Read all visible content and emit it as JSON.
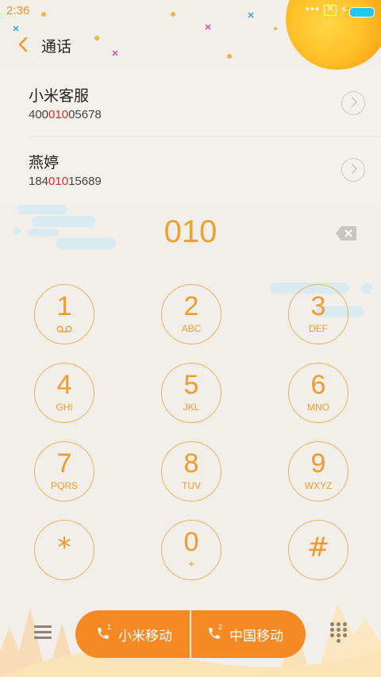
{
  "status_bar": {
    "time": "2:36"
  },
  "header": {
    "title": "通话",
    "back_icon": "chevron-left-icon"
  },
  "results": [
    {
      "name": "小米客服",
      "number_prefix": "400",
      "number_match": "010",
      "number_suffix": "05678"
    },
    {
      "name": "燕婷",
      "number_prefix": "184",
      "number_match": "010",
      "number_suffix": "15689"
    }
  ],
  "dial_input": "010",
  "keypad": [
    {
      "digit": "1",
      "letters": ""
    },
    {
      "digit": "2",
      "letters": "ABC"
    },
    {
      "digit": "3",
      "letters": "DEF"
    },
    {
      "digit": "4",
      "letters": "GHI"
    },
    {
      "digit": "5",
      "letters": "JKL"
    },
    {
      "digit": "6",
      "letters": "MNO"
    },
    {
      "digit": "7",
      "letters": "PQRS"
    },
    {
      "digit": "8",
      "letters": "TUV"
    },
    {
      "digit": "9",
      "letters": "WXYZ"
    },
    {
      "digit": "*",
      "letters": ""
    },
    {
      "digit": "0",
      "letters": "+"
    },
    {
      "digit": "#",
      "letters": ""
    }
  ],
  "bottom": {
    "sim1_label": "小米移动",
    "sim1_badge": "1",
    "sim2_label": "中国移动",
    "sim2_badge": "2"
  },
  "colors": {
    "accent": "#f29a2b",
    "match": "#e5262d",
    "call_button": "#f58a24"
  }
}
